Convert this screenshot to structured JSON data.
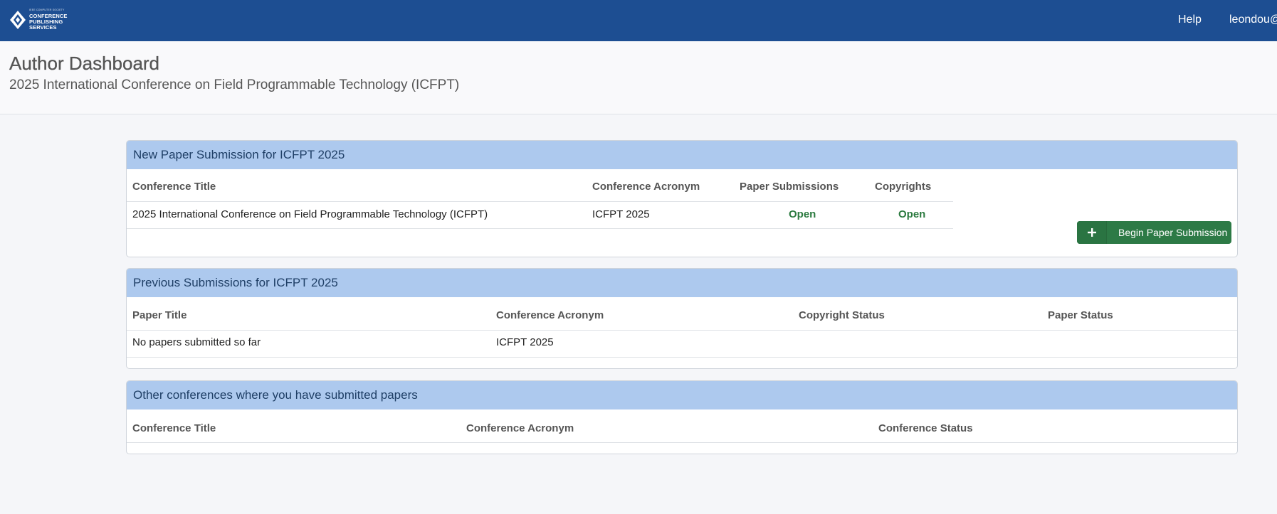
{
  "brand": {
    "small_text": "IEEE COMPUTER SOCIETY",
    "line1": "CONFERENCE",
    "line2": "PUBLISHING",
    "line3": "SERVICES"
  },
  "nav": {
    "help": "Help",
    "user": "leondou@"
  },
  "page": {
    "title": "Author Dashboard",
    "subtitle": "2025 International Conference on Field Programmable Technology (ICFPT)"
  },
  "new_submission": {
    "heading": "New Paper Submission for ICFPT 2025",
    "columns": [
      "Conference Title",
      "Conference Acronym",
      "Paper Submissions",
      "Copyrights"
    ],
    "rows": [
      {
        "title": "2025 International Conference on Field Programmable Technology (ICFPT)",
        "acronym": "ICFPT 2025",
        "paper_submissions": "Open",
        "copyrights": "Open"
      }
    ],
    "button_label": "Begin Paper Submission"
  },
  "previous": {
    "heading": "Previous Submissions for ICFPT 2025",
    "columns": [
      "Paper Title",
      "Conference Acronym",
      "Copyright Status",
      "Paper Status"
    ],
    "rows": [
      {
        "paper_title": "No papers submitted so far",
        "acronym": "ICFPT 2025",
        "copyright_status": "",
        "paper_status": ""
      }
    ]
  },
  "other": {
    "heading": "Other conferences where you have submitted papers",
    "columns": [
      "Conference Title",
      "Conference Acronym",
      "Conference Status"
    ]
  },
  "colors": {
    "topbar": "#1d4e92",
    "panel_heading": "#adc9ee",
    "open_status": "#2b7a3f",
    "button": "#2d7a46"
  },
  "icons": [
    "logo-mark-icon",
    "plus-icon"
  ]
}
